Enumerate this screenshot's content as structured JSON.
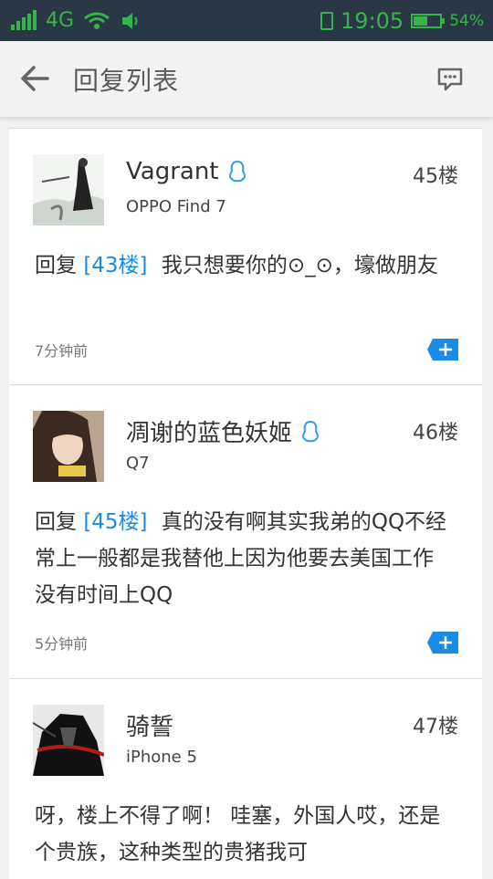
{
  "status_bar": {
    "network": "4G",
    "time": "19:05",
    "battery": "54%",
    "battery_level": 0.54
  },
  "header": {
    "title": "回复列表"
  },
  "posts": [
    {
      "name": "Vagrant",
      "device": "OPPO Find 7",
      "floor": "45楼",
      "reply_prefix": "回复",
      "reply_ref": "[43楼]",
      "content": "我只想要你的⊙_⊙，壕做朋友",
      "time": "7分钟前"
    },
    {
      "name": "凋谢的蓝色妖姬",
      "device": "Q7",
      "floor": "46楼",
      "reply_prefix": "回复",
      "reply_ref": "[45楼]",
      "content": "真的没有啊其实我弟的QQ不经常上一般都是我替他上因为他要去美国工作没有时间上QQ",
      "time": "5分钟前"
    },
    {
      "name": "骑誓",
      "device": "iPhone 5",
      "floor": "47楼",
      "content": "呀，楼上不得了啊！ 哇塞，外国人哎，还是个贵族，这种类型的贵猪我可"
    }
  ]
}
